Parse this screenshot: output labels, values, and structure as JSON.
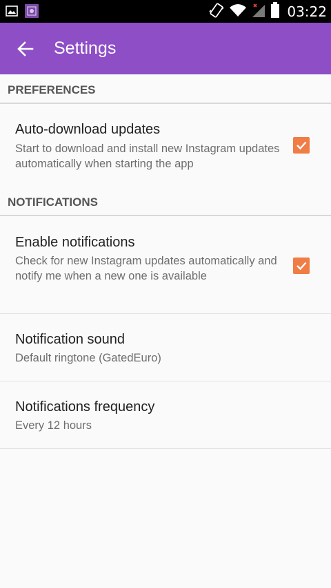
{
  "status_bar": {
    "time": "03:22",
    "icons": [
      "image-notification-icon",
      "app-notification-icon",
      "vibrate-icon",
      "wifi-icon",
      "signal-icon",
      "battery-icon"
    ]
  },
  "toolbar": {
    "title": "Settings",
    "back_icon": "arrow-left-icon",
    "color": "#8e4ec6"
  },
  "sections": {
    "preferences": {
      "header": "PREFERENCES",
      "auto_download": {
        "title": "Auto-download updates",
        "summary": "Start to download and install new Instagram updates automatically when starting the app",
        "checked": true
      }
    },
    "notifications": {
      "header": "NOTIFICATIONS",
      "enable": {
        "title": "Enable notifications",
        "summary": "Check for new Instagram updates automatically and notify me when a new one is available",
        "checked": true
      },
      "sound": {
        "title": "Notification sound",
        "summary": "Default ringtone (GatedEuro)"
      },
      "frequency": {
        "title": "Notifications frequency",
        "summary": "Every 12 hours"
      }
    }
  },
  "colors": {
    "accent": "#ef7d45",
    "background": "#fafafa"
  }
}
